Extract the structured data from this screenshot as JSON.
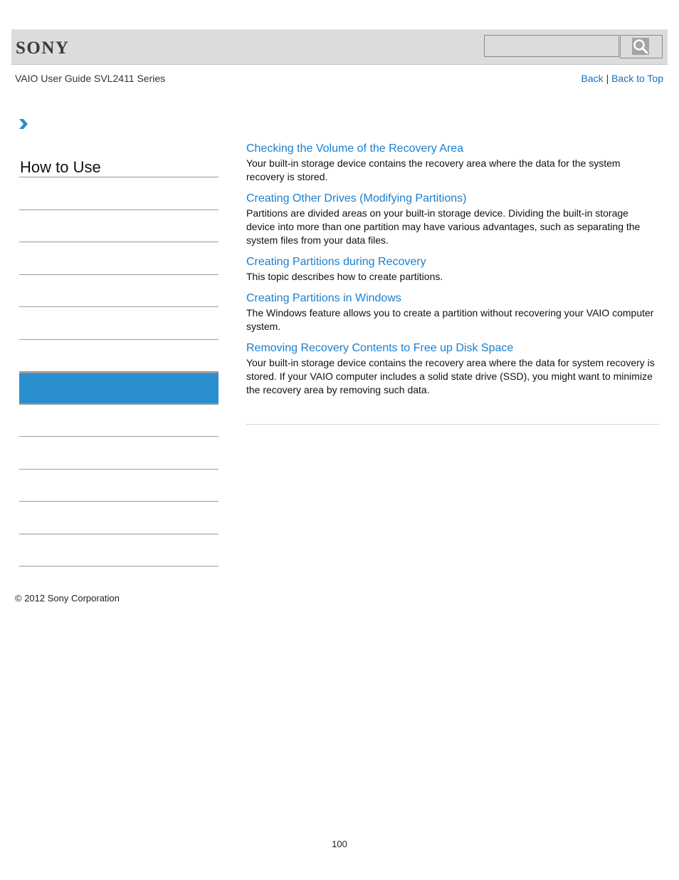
{
  "header": {
    "logo": "SONY",
    "search": {
      "placeholder": "",
      "value": ""
    },
    "search_icon": "magnifier-icon"
  },
  "subheader": {
    "guide_title": "VAIO User Guide SVL2411 Series",
    "back_label": "Back",
    "separator": "|",
    "back_to_top_label": "Back to Top"
  },
  "breadcrumb": {
    "icon": "chevron-right-icon"
  },
  "sidebar": {
    "title": "How to Use",
    "items_count": 12,
    "active_index": 7,
    "accent_color": "#2a8fcd"
  },
  "topics": [
    {
      "title": "Checking the Volume of the Recovery Area",
      "description": "Your built-in storage device contains the recovery area where the data for the system recovery is stored."
    },
    {
      "title": "Creating Other Drives (Modifying Partitions)",
      "description": "Partitions are divided areas on your built-in storage device. Dividing the built-in storage device into more than one partition may have various advantages, such as separating the system files from your data files."
    },
    {
      "title": "Creating Partitions during Recovery",
      "description": "This topic describes how to create partitions."
    },
    {
      "title": "Creating Partitions in Windows",
      "description": "The Windows feature allows you to create a partition without recovering your VAIO computer system."
    },
    {
      "title": "Removing Recovery Contents to Free up Disk Space",
      "description": "Your built-in storage device contains the recovery area where the data for system recovery is stored. If your VAIO computer includes a solid state drive (SSD), you might want to minimize the recovery area by removing such data."
    }
  ],
  "footer": {
    "copyright": "© 2012 Sony Corporation",
    "page_number": "100"
  }
}
